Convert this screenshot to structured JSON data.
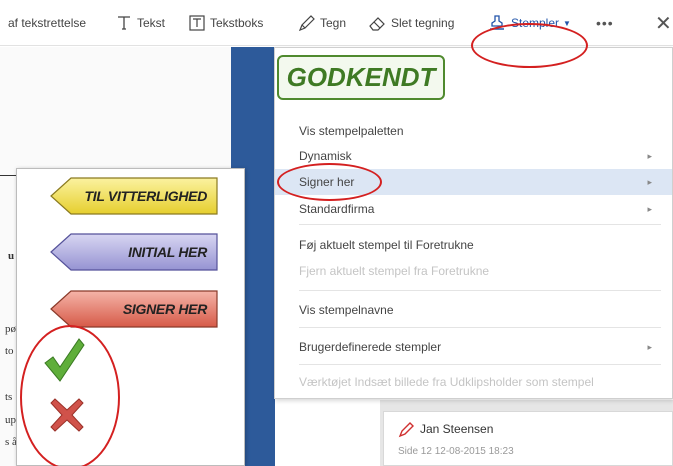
{
  "toolbar": {
    "items": [
      {
        "label": "af tekstrettelse"
      },
      {
        "label": "Tekst",
        "icon": "text-icon"
      },
      {
        "label": "Tekstboks",
        "icon": "textbox-icon"
      },
      {
        "label": "Tegn",
        "icon": "pencil-icon"
      },
      {
        "label": "Slet tegning",
        "icon": "eraser-icon"
      },
      {
        "label": "Stempler",
        "icon": "stamp-icon"
      }
    ],
    "more": "•••",
    "close": "✕"
  },
  "stamp_preview": {
    "text": "GODKENDT",
    "color": "#3f7a24"
  },
  "menu": {
    "items": [
      {
        "label": "Vis stempelpaletten"
      },
      {
        "label": "Dynamisk",
        "submenu": "▸"
      },
      {
        "label": "Signer her",
        "submenu": "▸"
      },
      {
        "label": "Standardfirma",
        "submenu": "▸"
      },
      {
        "label": "Føj aktuelt stempel til Foretrukne"
      },
      {
        "label": "Fjern aktuelt stempel fra Foretrukne"
      },
      {
        "label": "Vis stempelnavne"
      },
      {
        "label": "Brugerdefinerede stempler",
        "submenu": "▸"
      },
      {
        "label": "Værktøjet Indsæt billede fra Udklipsholder som stempel"
      }
    ]
  },
  "palette": {
    "stamps": [
      {
        "label": "TIL VITTERLIGHED",
        "color": "#f2e25c"
      },
      {
        "label": "INITIAL HER",
        "color": "#a9a6dc"
      },
      {
        "label": "SIGNER HER",
        "color": "#e07060"
      }
    ],
    "check_icon": "checkmark-icon",
    "x_icon": "x-icon"
  },
  "document": {
    "fragments": [
      "u",
      "pø",
      "to",
      "ts",
      "up",
      "s å"
    ]
  },
  "comment": {
    "author": "Jan Steensen",
    "meta": "Side 12   12-08-2015 18:23"
  },
  "colors": {
    "annotation": "#d42020",
    "menu_highlight": "#dce6f4",
    "blue_strip": "#2d5a9a"
  }
}
